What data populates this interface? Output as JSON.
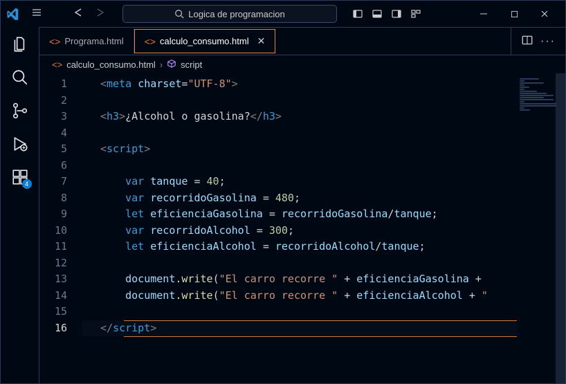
{
  "titlebar": {
    "search_text": "Logica de programacion"
  },
  "activitybar": {
    "badge_count": "4"
  },
  "tabs": [
    {
      "label": "Programa.html",
      "active": false,
      "closeable": false
    },
    {
      "label": "calculo_consumo.html",
      "active": true,
      "closeable": true
    }
  ],
  "breadcrumb": {
    "file": "calculo_consumo.html",
    "symbol": "script"
  },
  "code": {
    "line_count": 16,
    "current_line": 16,
    "lines": {
      "1": {
        "indent": 0,
        "tokens": [
          [
            "br",
            "<"
          ],
          [
            "tag",
            "meta"
          ],
          [
            "txt",
            " "
          ],
          [
            "attr",
            "charset"
          ],
          [
            "op",
            "="
          ],
          [
            "str",
            "\"UTF-8\""
          ],
          [
            "br",
            ">"
          ]
        ]
      },
      "2": {
        "indent": 0,
        "tokens": []
      },
      "3": {
        "indent": 0,
        "tokens": [
          [
            "br",
            "<"
          ],
          [
            "tag",
            "h3"
          ],
          [
            "br",
            ">"
          ],
          [
            "txt",
            "¿Alcohol o gasolina?"
          ],
          [
            "br",
            "</"
          ],
          [
            "tag",
            "h3"
          ],
          [
            "br",
            ">"
          ]
        ]
      },
      "4": {
        "indent": 0,
        "tokens": []
      },
      "5": {
        "indent": 0,
        "tokens": [
          [
            "br",
            "<"
          ],
          [
            "tag",
            "script"
          ],
          [
            "br",
            ">"
          ]
        ]
      },
      "6": {
        "indent": 0,
        "tokens": []
      },
      "7": {
        "indent": 1,
        "tokens": [
          [
            "kw",
            "var"
          ],
          [
            "txt",
            " "
          ],
          [
            "var",
            "tanque"
          ],
          [
            "txt",
            " "
          ],
          [
            "op",
            "="
          ],
          [
            "txt",
            " "
          ],
          [
            "num",
            "40"
          ],
          [
            "semi",
            ";"
          ]
        ]
      },
      "8": {
        "indent": 1,
        "tokens": [
          [
            "kw",
            "var"
          ],
          [
            "txt",
            " "
          ],
          [
            "var",
            "recorridoGasolina"
          ],
          [
            "txt",
            " "
          ],
          [
            "op",
            "="
          ],
          [
            "txt",
            " "
          ],
          [
            "num",
            "480"
          ],
          [
            "semi",
            ";"
          ]
        ]
      },
      "9": {
        "indent": 1,
        "tokens": [
          [
            "kw",
            "let"
          ],
          [
            "txt",
            " "
          ],
          [
            "var",
            "eficienciaGasolina"
          ],
          [
            "txt",
            " "
          ],
          [
            "op",
            "="
          ],
          [
            "txt",
            " "
          ],
          [
            "var",
            "recorridoGasolina"
          ],
          [
            "op",
            "/"
          ],
          [
            "var",
            "tanque"
          ],
          [
            "semi",
            ";"
          ]
        ]
      },
      "10": {
        "indent": 1,
        "tokens": [
          [
            "kw",
            "var"
          ],
          [
            "txt",
            " "
          ],
          [
            "var",
            "recorridoAlcohol"
          ],
          [
            "txt",
            " "
          ],
          [
            "op",
            "="
          ],
          [
            "txt",
            " "
          ],
          [
            "num",
            "300"
          ],
          [
            "semi",
            ";"
          ]
        ]
      },
      "11": {
        "indent": 1,
        "tokens": [
          [
            "kw",
            "let"
          ],
          [
            "txt",
            " "
          ],
          [
            "var",
            "eficienciaAlcohol"
          ],
          [
            "txt",
            " "
          ],
          [
            "op",
            "="
          ],
          [
            "txt",
            " "
          ],
          [
            "var",
            "recorridoAlcohol"
          ],
          [
            "op",
            "/"
          ],
          [
            "var",
            "tanque"
          ],
          [
            "semi",
            ";"
          ]
        ]
      },
      "12": {
        "indent": 0,
        "tokens": []
      },
      "13": {
        "indent": 1,
        "tokens": [
          [
            "var",
            "document"
          ],
          [
            "txt",
            "."
          ],
          [
            "fn",
            "write"
          ],
          [
            "txt",
            "("
          ],
          [
            "str",
            "\"El carro recorre \""
          ],
          [
            "txt",
            " "
          ],
          [
            "op",
            "+"
          ],
          [
            "txt",
            " "
          ],
          [
            "var",
            "eficienciaGasolina"
          ],
          [
            "txt",
            " "
          ],
          [
            "op",
            "+"
          ]
        ]
      },
      "14": {
        "indent": 1,
        "tokens": [
          [
            "var",
            "document"
          ],
          [
            "txt",
            "."
          ],
          [
            "fn",
            "write"
          ],
          [
            "txt",
            "("
          ],
          [
            "str",
            "\"El carro recorre \""
          ],
          [
            "txt",
            " "
          ],
          [
            "op",
            "+"
          ],
          [
            "txt",
            " "
          ],
          [
            "var",
            "eficienciaAlcohol"
          ],
          [
            "txt",
            " "
          ],
          [
            "op",
            "+"
          ],
          [
            "txt",
            " "
          ],
          [
            "str",
            "\""
          ]
        ]
      },
      "15": {
        "indent": 0,
        "tokens": []
      },
      "16": {
        "indent": 0,
        "tokens": [
          [
            "br",
            "</"
          ],
          [
            "tag",
            "script"
          ],
          [
            "br",
            ">"
          ]
        ]
      }
    }
  }
}
